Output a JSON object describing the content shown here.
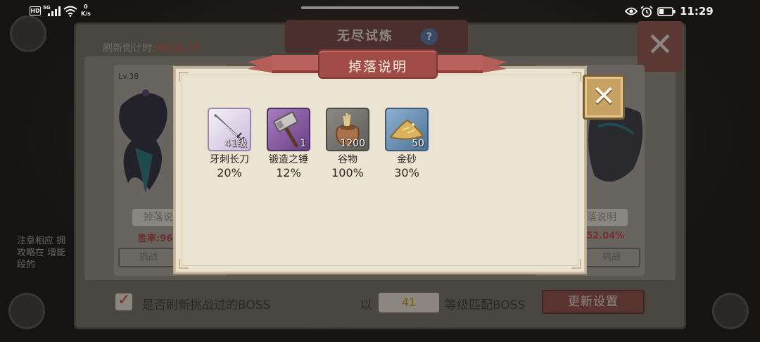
{
  "status_bar": {
    "hd": "HD",
    "network": "5G",
    "speed_value": "0",
    "speed_unit": "K/s",
    "time": "11:29"
  },
  "background_panel": {
    "title": "无尽试炼",
    "help": "?",
    "refresh_countdown_label": "刷新倒计时:",
    "refresh_countdown_value": "06:30:37",
    "left_card": {
      "level": "Lv.38",
      "drop_button": "掉落说明",
      "winrate": "胜率:96.6",
      "challenge_button": "挑战"
    },
    "right_card": {
      "drop_button": "落说明",
      "winrate": ":52.04%",
      "challenge_button": "挑战"
    },
    "side_text": "注意相应 拥攻略在 增能段的",
    "refresh_defeated_label": "是否刷新挑战过的BOSS",
    "refresh_defeated_checked": true,
    "match_prefix": "以",
    "match_level": "41",
    "match_suffix": "等级匹配BOSS",
    "update_button": "更新设置",
    "close_icon_label": "✕"
  },
  "dialog": {
    "title": "掉落说明",
    "close_label": "✕",
    "items": [
      {
        "name": "牙刺长刀",
        "count": "41级",
        "rate": "20%",
        "icon": "spear-blade-icon",
        "frame": "silver"
      },
      {
        "name": "锻造之锤",
        "count": "1",
        "rate": "12%",
        "icon": "forge-hammer-icon",
        "frame": "purple"
      },
      {
        "name": "谷物",
        "count": "1200",
        "rate": "100%",
        "icon": "grain-sack-icon",
        "frame": "gray"
      },
      {
        "name": "金砂",
        "count": "50",
        "rate": "30%",
        "icon": "gold-sand-icon",
        "frame": "blue"
      }
    ]
  },
  "colors": {
    "dialog_bg": "#ece4d2",
    "title_plate": "#a14c48",
    "close_button": "#c8a164",
    "timer_red": "#8c2f2a"
  }
}
